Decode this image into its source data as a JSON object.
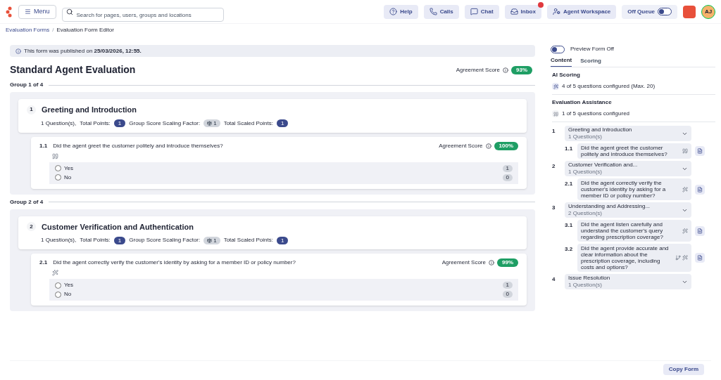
{
  "topbar": {
    "menu": "Menu",
    "search": {
      "placeholder": "Search for pages, users, groups and locations"
    },
    "buttons": [
      {
        "kind": "help",
        "label": "Help",
        "badge": false
      },
      {
        "kind": "calls",
        "label": "Calls",
        "badge": false
      },
      {
        "kind": "chat",
        "label": "Chat",
        "badge": false
      },
      {
        "kind": "inbox",
        "label": "Inbox",
        "badge": true
      },
      {
        "kind": "agent",
        "label": "Agent Workspace",
        "badge": false
      }
    ],
    "queue": {
      "label": "Off Queue",
      "on": false
    },
    "avatar": "AJ"
  },
  "breadcrumb": {
    "items": [
      "Evaluation Forms",
      "Evaluation Form Editor"
    ],
    "separator": "/"
  },
  "banner": "This form was published on **25/03/2026, 12:55.**",
  "form": {
    "title": "Standard Agent Evaluation",
    "agreement_label": "Agreement Score",
    "agreement_value": "93%",
    "groups": [
      {
        "label": "Group 1 of 4",
        "number": "1",
        "title": "Greeting and Introduction",
        "count": "1 Question(s),",
        "points_label": "Total Points:",
        "points": "1",
        "scaling_label": "Group Score Scaling Factor:",
        "scaling": "1",
        "scaled_label": "Total Scaled Points:",
        "scaled": "1",
        "questions": [
          {
            "number": "1.1",
            "text": "Did the agent greet the customer politely and introduce themselves?",
            "agreement_label": "Agreement Score",
            "agreement_value": "100%",
            "assist": {
              "kind": "quote"
            },
            "options": [
              {
                "label": "Yes",
                "points": "1",
                "selected": false
              },
              {
                "label": "No",
                "points": "0",
                "selected": false
              }
            ]
          }
        ]
      },
      {
        "label": "Group 2 of 4",
        "number": "2",
        "title": "Customer Verification and Authentication",
        "count": "1 Question(s),",
        "points_label": "Total Points:",
        "points": "1",
        "scaling_label": "Group Score Scaling Factor:",
        "scaling": "1",
        "scaled_label": "Total Scaled Points:",
        "scaled": "1",
        "questions": [
          {
            "number": "2.1",
            "text": "Did the agent correctly verify the customer's identity by asking for a member ID or policy number?",
            "agreement_label": "Agreement Score",
            "agreement_value": "99%",
            "assist": {
              "kind": "wand"
            },
            "options": [
              {
                "label": "Yes",
                "points": "1",
                "selected": false
              },
              {
                "label": "No",
                "points": "0",
                "selected": false
              }
            ]
          }
        ]
      }
    ]
  },
  "sidebar": {
    "preview": {
      "label": "Preview Form Off",
      "on": false
    },
    "tabs": [
      {
        "label": "Content",
        "selected": true
      },
      {
        "label": "Scoring",
        "selected": false
      }
    ],
    "ai_scoring": {
      "title": "AI Scoring",
      "text": "4 of 5 questions configured (Max. 20)"
    },
    "assistance": {
      "title": "Evaluation Assistance",
      "text": "1 of 5 questions configured"
    },
    "outline": [
      {
        "number": "1",
        "title": "Greeting and Introduction",
        "count": "1 Question(s)",
        "children": [
          {
            "number": "1.1",
            "text": "Did the agent greet the customer politely and introduce themselves?",
            "icons": [
              {
                "kind": "quote"
              }
            ]
          }
        ]
      },
      {
        "number": "2",
        "title": "Customer Verification and...",
        "count": "1 Question(s)",
        "children": [
          {
            "number": "2.1",
            "text": "Did the agent correctly verify the customer's identity by asking for a member ID or policy number?",
            "icons": [
              {
                "kind": "wand"
              }
            ]
          }
        ]
      },
      {
        "number": "3",
        "title": "Understanding and Addressing...",
        "count": "2 Question(s)",
        "children": [
          {
            "number": "3.1",
            "text": "Did the agent listen carefully and understand the customer's query regarding prescription coverage?",
            "icons": [
              {
                "kind": "wand"
              }
            ]
          },
          {
            "number": "3.2",
            "text": "Did the agent provide accurate and clear information about the prescription coverage, including costs and options?",
            "icons": [
              {
                "kind": "branch"
              },
              {
                "kind": "wand"
              }
            ]
          }
        ]
      },
      {
        "number": "4",
        "title": "Issue Resolution",
        "count": "1 Question(s)"
      }
    ]
  },
  "footer": {
    "button": "Copy Form"
  }
}
